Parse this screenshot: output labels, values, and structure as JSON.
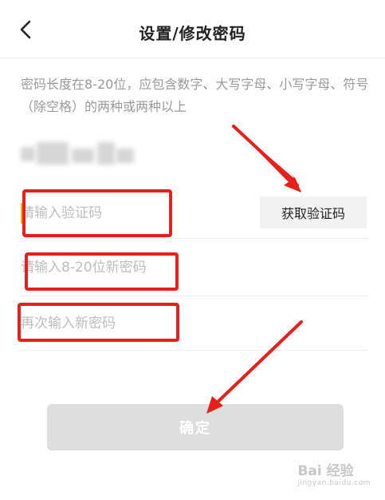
{
  "nav": {
    "title": "设置/修改密码",
    "back_icon": "chevron-left-icon"
  },
  "hint": "密码长度在8-20位，应包含数字、大写字母、小写字母、符号（除空格）的两种或两种以上",
  "form": {
    "code_placeholder": "请输入验证码",
    "get_code_label": "获取验证码",
    "new_password_placeholder": "请输入8-20位新密码",
    "confirm_password_placeholder": "再次输入新密码"
  },
  "confirm_label": "确定",
  "annotation": {
    "highlight_color": "#e8201a",
    "arrow_color": "#e8201a"
  },
  "watermark": {
    "brand": "Bai 经验",
    "url": "jingyan.baidu.com"
  },
  "colors": {
    "accent_cursor": "#f4b400",
    "button_disabled_bg": "#dedede",
    "hint_text": "#9a9a9a"
  }
}
